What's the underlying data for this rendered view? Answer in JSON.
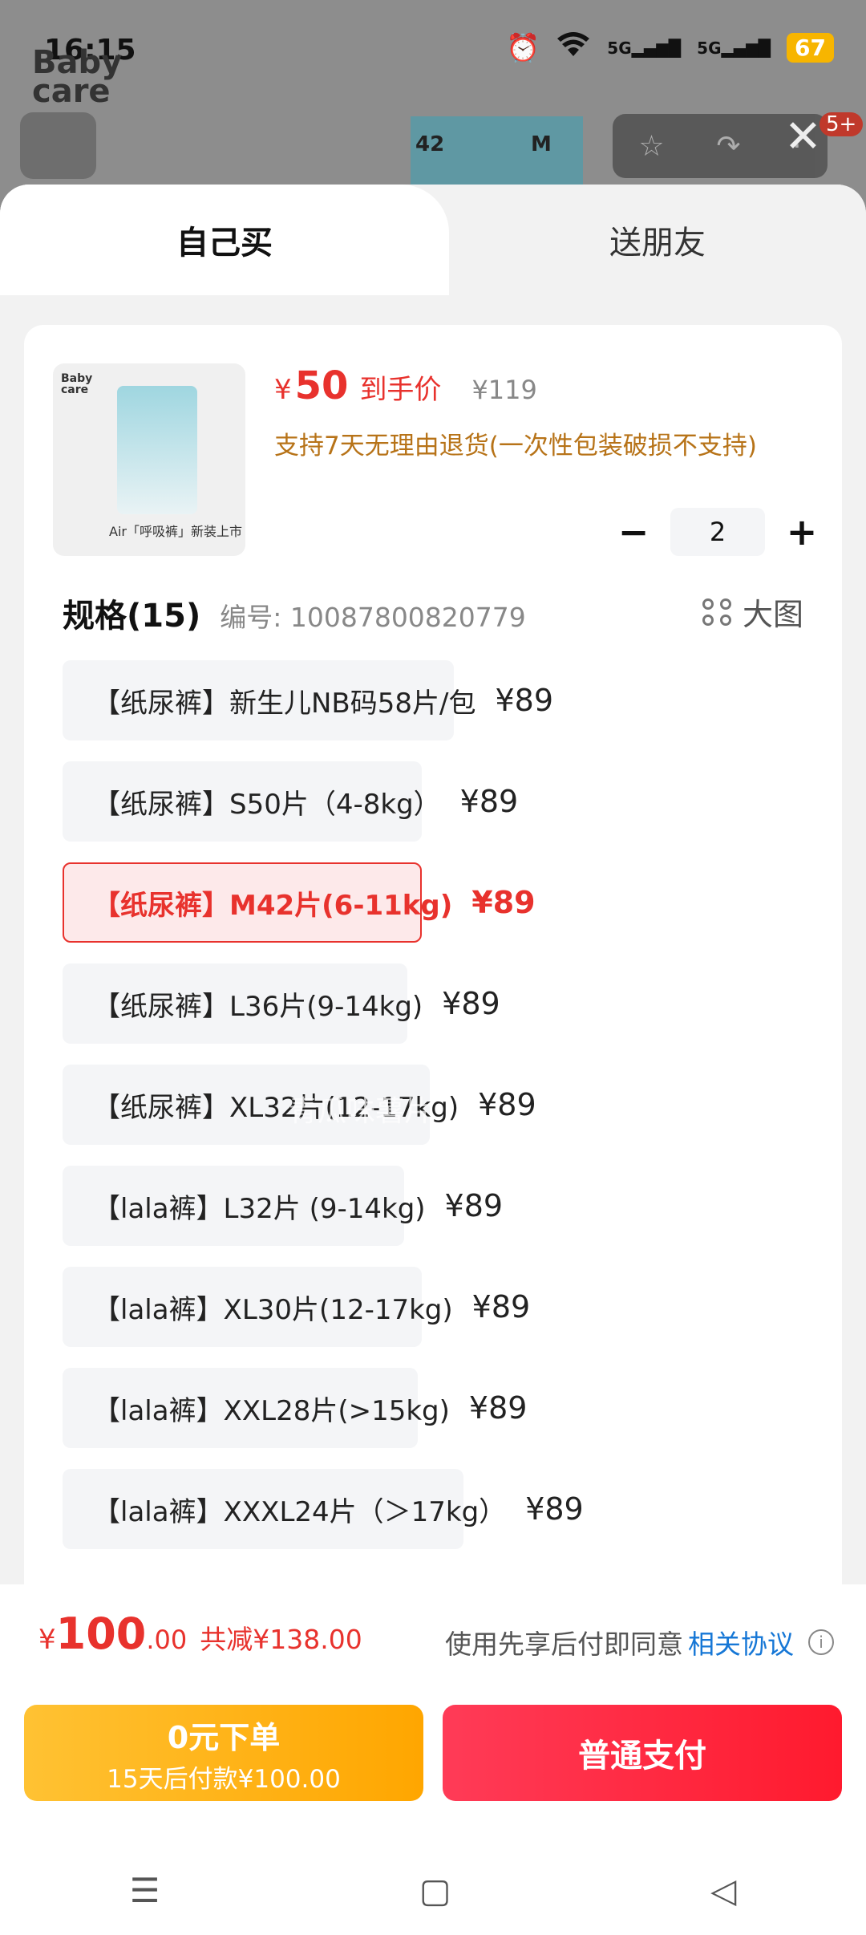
{
  "status": {
    "time": "16:15",
    "alarm_icon": "alarm-icon",
    "wifi_icon": "wifi-icon",
    "signal1": "5G",
    "signal2": "5G",
    "battery": "67"
  },
  "background": {
    "logo": "Baby care",
    "thumb_size": "42",
    "thumb_label": "M",
    "badge": "5+"
  },
  "tabs": {
    "self": "自己买",
    "friend": "送朋友"
  },
  "product": {
    "price_symbol": "¥",
    "price": "50",
    "price_label": "到手价",
    "original_price": "¥119",
    "return_note": "支持7天无理由退货(一次性包装破损不支持)",
    "image_logo": "Baby care",
    "image_caption": "Air「呼吸裤」新装上市",
    "quantity": "2",
    "minus": "−",
    "plus": "+"
  },
  "spec": {
    "title": "规格(15)",
    "code": "编号: 10087800820779",
    "big_image": "大图",
    "items": [
      {
        "label": "【纸尿裤】新生儿NB码58片/包",
        "price": "¥89",
        "selected": false
      },
      {
        "label": "【纸尿裤】S50片（4-8kg）",
        "price": "¥89",
        "selected": false
      },
      {
        "label": "【纸尿裤】M42片(6-11kg)",
        "price": "¥89",
        "selected": true
      },
      {
        "label": "【纸尿裤】L36片(9-14kg)",
        "price": "¥89",
        "selected": false
      },
      {
        "label": "【纸尿裤】XL32片(12-17kg)",
        "price": "¥89",
        "selected": false
      },
      {
        "label": "【lala裤】L32片 (9-14kg)",
        "price": "¥89",
        "selected": false
      },
      {
        "label": "【lala裤】XL30片(12-17kg)",
        "price": "¥89",
        "selected": false
      },
      {
        "label": "【lala裤】XXL28片(>15kg)",
        "price": "¥89",
        "selected": false
      },
      {
        "label": "【lala裤】XXXL24片（＞17kg）",
        "price": "¥89",
        "selected": false
      }
    ],
    "watermark": "青瓜味薯片"
  },
  "footer": {
    "total_symbol": "¥",
    "total_int": "100",
    "total_dec": ".00",
    "saved": "共减¥138.00",
    "agree_text": "使用先享后付即同意",
    "agree_link": "相关协议",
    "zero_line1": "0元下单",
    "zero_line2": "15天后付款¥100.00",
    "pay": "普通支付"
  },
  "navbar": {
    "menu_icon": "menu-icon",
    "home_icon": "home-icon",
    "back_icon": "back-icon"
  }
}
